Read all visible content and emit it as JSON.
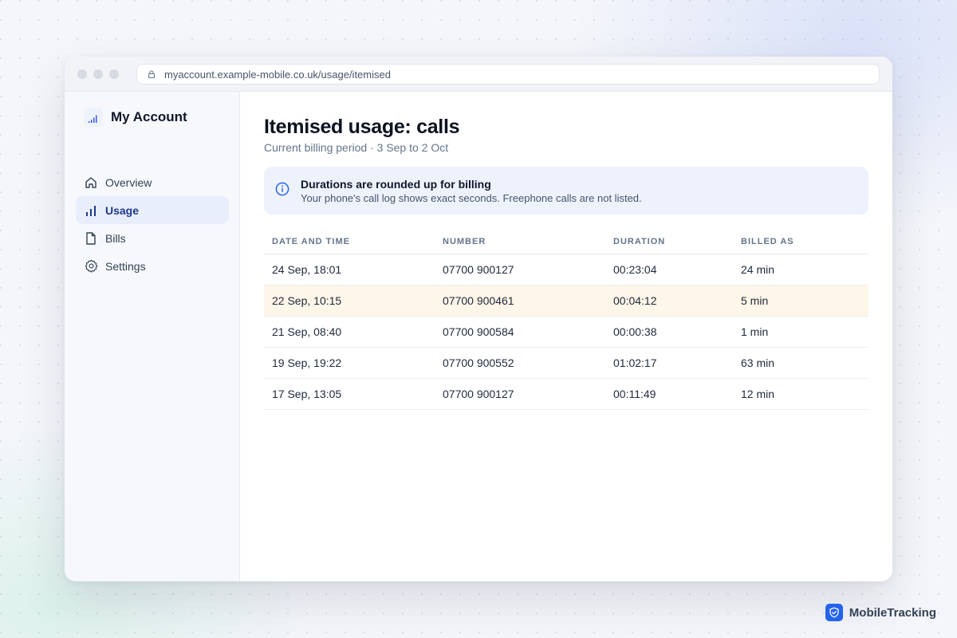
{
  "browser": {
    "url": "myaccount.example-mobile.co.uk/usage/itemised"
  },
  "sidebar": {
    "brand": "My Account",
    "items": [
      {
        "label": "Overview",
        "icon": "home-icon",
        "active": false
      },
      {
        "label": "Usage",
        "icon": "bar-chart-icon",
        "active": true
      },
      {
        "label": "Bills",
        "icon": "document-icon",
        "active": false
      },
      {
        "label": "Settings",
        "icon": "gear-icon",
        "active": false
      }
    ]
  },
  "main": {
    "title": "Itemised usage: calls",
    "subtitle": "Current billing period · 3 Sep to 2 Oct",
    "notice": {
      "title": "Durations are rounded up for billing",
      "body": "Your phone's call log shows exact seconds. Freephone calls are not listed."
    },
    "table": {
      "columns": [
        "DATE AND TIME",
        "NUMBER",
        "DURATION",
        "BILLED AS"
      ],
      "rows": [
        {
          "datetime": "24 Sep, 18:01",
          "number": "07700 900127",
          "duration": "00:23:04",
          "billed": "24 min",
          "highlighted": false
        },
        {
          "datetime": "22 Sep, 10:15",
          "number": "07700 900461",
          "duration": "00:04:12",
          "billed": "5 min",
          "highlighted": true
        },
        {
          "datetime": "21 Sep, 08:40",
          "number": "07700 900584",
          "duration": "00:00:38",
          "billed": "1 min",
          "highlighted": false
        },
        {
          "datetime": "19 Sep, 19:22",
          "number": "07700 900552",
          "duration": "01:02:17",
          "billed": "63 min",
          "highlighted": false
        },
        {
          "datetime": "17 Sep, 13:05",
          "number": "07700 900127",
          "duration": "00:11:49",
          "billed": "12 min",
          "highlighted": false
        }
      ]
    }
  },
  "watermark": {
    "label": "MobileTracking",
    "icon": "shield-check-icon"
  },
  "colors": {
    "accent": "#2563eb",
    "active_nav_bg": "#e9eefb",
    "notice_bg": "#edf2fc",
    "highlight_row": "#fef6e8"
  }
}
